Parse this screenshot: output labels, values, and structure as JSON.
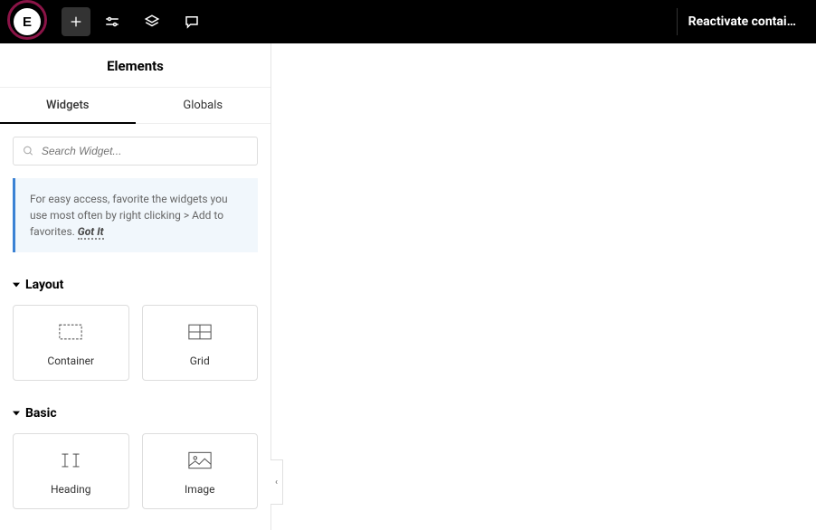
{
  "topbar": {
    "logo_text": "E",
    "reactivate_label": "Reactivate contai…"
  },
  "panel": {
    "title": "Elements",
    "tabs": {
      "widgets": "Widgets",
      "globals": "Globals"
    },
    "search": {
      "placeholder": "Search Widget..."
    },
    "tip": {
      "text": "For easy access, favorite the widgets you use most often by right clicking > Add to favorites. ",
      "link": "Got It"
    },
    "sections": {
      "layout": {
        "title": "Layout",
        "widgets": [
          {
            "name": "container",
            "label": "Container"
          },
          {
            "name": "grid",
            "label": "Grid"
          }
        ]
      },
      "basic": {
        "title": "Basic",
        "widgets": [
          {
            "name": "heading",
            "label": "Heading"
          },
          {
            "name": "image",
            "label": "Image"
          }
        ]
      }
    }
  },
  "collapse_icon": "‹"
}
